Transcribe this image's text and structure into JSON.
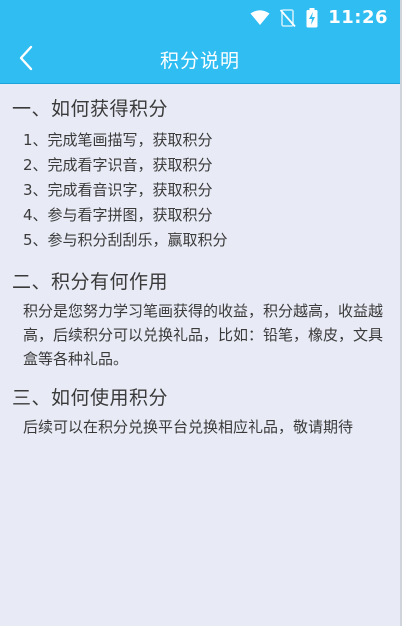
{
  "status_bar": {
    "time": "11:26",
    "icons": [
      "wifi-icon",
      "no-signal-icon",
      "battery-charging-icon"
    ]
  },
  "app_bar": {
    "title": "积分说明",
    "back_icon": "chevron-left-icon"
  },
  "sections": [
    {
      "heading": "一、如何获得积分",
      "items": [
        "1、完成笔画描写，获取积分",
        "2、完成看字识音，获取积分",
        "3、完成看音识字，获取积分",
        "4、参与看字拼图，获取积分",
        "5、参与积分刮刮乐，赢取积分"
      ]
    },
    {
      "heading": "二、积分有何作用",
      "text": "积分是您努力学习笔画获得的收益，积分越高，收益越高，后续积分可以兑换礼品，比如：铅笔，橡皮，文具盒等各种礼品。"
    },
    {
      "heading": "三、如何使用积分",
      "text": "后续可以在积分兑换平台兑换相应礼品，敬请期待"
    }
  ],
  "colors": {
    "header": "#2fbdf2",
    "background": "#e8ebf6",
    "text": "#3a3a3a"
  }
}
